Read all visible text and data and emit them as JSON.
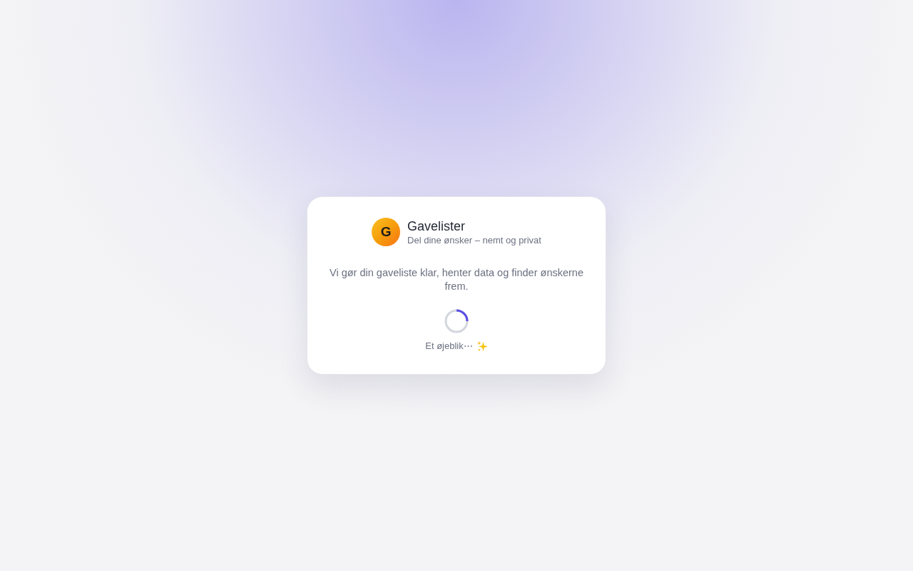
{
  "brand": {
    "logo_letter": "G",
    "name": "Gavelister",
    "tagline": "Del dine ønsker – nemt og privat"
  },
  "message": "Vi gør din gaveliste klar, henter data og finder ønskerne frem.",
  "loading": {
    "label": "Et øjeblik⋯"
  }
}
